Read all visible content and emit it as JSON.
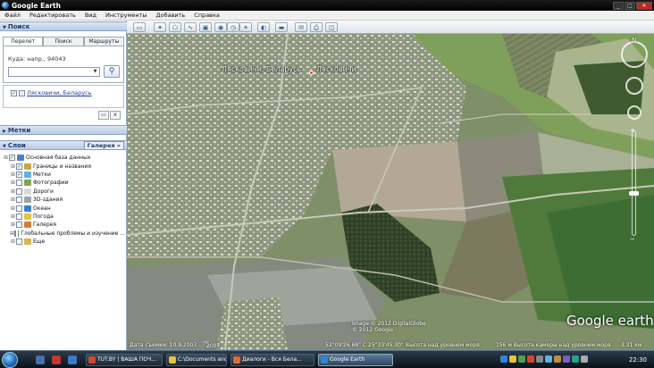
{
  "window": {
    "title": "Google Earth"
  },
  "menu": [
    "Файл",
    "Редактировать",
    "Вид",
    "Инструменты",
    "Добавить",
    "Справка"
  ],
  "search_panel": {
    "header": "Поиск",
    "tabs": [
      "Перелет",
      "Поиск компаний",
      "Маршруты"
    ],
    "where_label": "Куда: напр., 94043",
    "input_value": "",
    "search_button": "Q",
    "result_link": "Лясковичи, Беларусь",
    "btn_small_1": "",
    "btn_close": "x"
  },
  "places_panel": {
    "header": "Метки"
  },
  "layers_panel": {
    "header": "Слои",
    "gallery_button": "Галерея »",
    "items": [
      {
        "label": "Основная база данных",
        "checked": true,
        "icon_color": "#4a7fd0"
      },
      {
        "label": "Границы и названия",
        "checked": true,
        "icon_color": "#c9a640"
      },
      {
        "label": "Метки",
        "checked": true,
        "icon_color": "#5bb4e6"
      },
      {
        "label": "Фотографии",
        "checked": false,
        "icon_color": "#7fa84c"
      },
      {
        "label": "Дороги",
        "checked": false,
        "icon_color": "#d9d9d9"
      },
      {
        "label": "3D-здания",
        "checked": false,
        "icon_color": "#9aa4b0"
      },
      {
        "label": "Океан",
        "checked": false,
        "icon_color": "#3b7fd4"
      },
      {
        "label": "Погода",
        "checked": false,
        "icon_color": "#e8c23c"
      },
      {
        "label": "Галерея",
        "checked": false,
        "icon_color": "#d87a3a"
      },
      {
        "label": "Глобальные проблемы и изучение ...",
        "checked": false,
        "icon_color": "#4f9e56"
      },
      {
        "label": "Еще",
        "checked": false,
        "icon_color": "#d8b44a"
      }
    ]
  },
  "map": {
    "place_label_1": "Лясковичи, Беларусь",
    "place_label_2": "Лясковичи",
    "imagery_date_label": "Дата съемки: 10.9.2007",
    "year_badge": "2007",
    "coordinates": "52°09'26.68\" С  25°33'45.30\" В",
    "elevation": "Высота над уровнем моря",
    "eye_alt": "156 м Высота камеры над уровнем моря",
    "eye_alt_value": "3.31 км",
    "copyright": "Image © 2012 DigitalGlobe\n© 2012 Google",
    "logo": "Google earth",
    "scale_icon": "scale-icon"
  },
  "taskbar": {
    "tasks": [
      {
        "label": "TUT.BY | ВАША ПОЧ...",
        "color": "#d9452f",
        "active": false
      },
      {
        "label": "C:\\Documents and S...",
        "color": "#e8c23c",
        "active": false
      },
      {
        "label": "Диалоги - Вся Бела...",
        "color": "#e46a2a",
        "active": false
      },
      {
        "label": "Google Earth",
        "color": "#2f86d8",
        "active": true
      }
    ],
    "clock": "22:30"
  }
}
